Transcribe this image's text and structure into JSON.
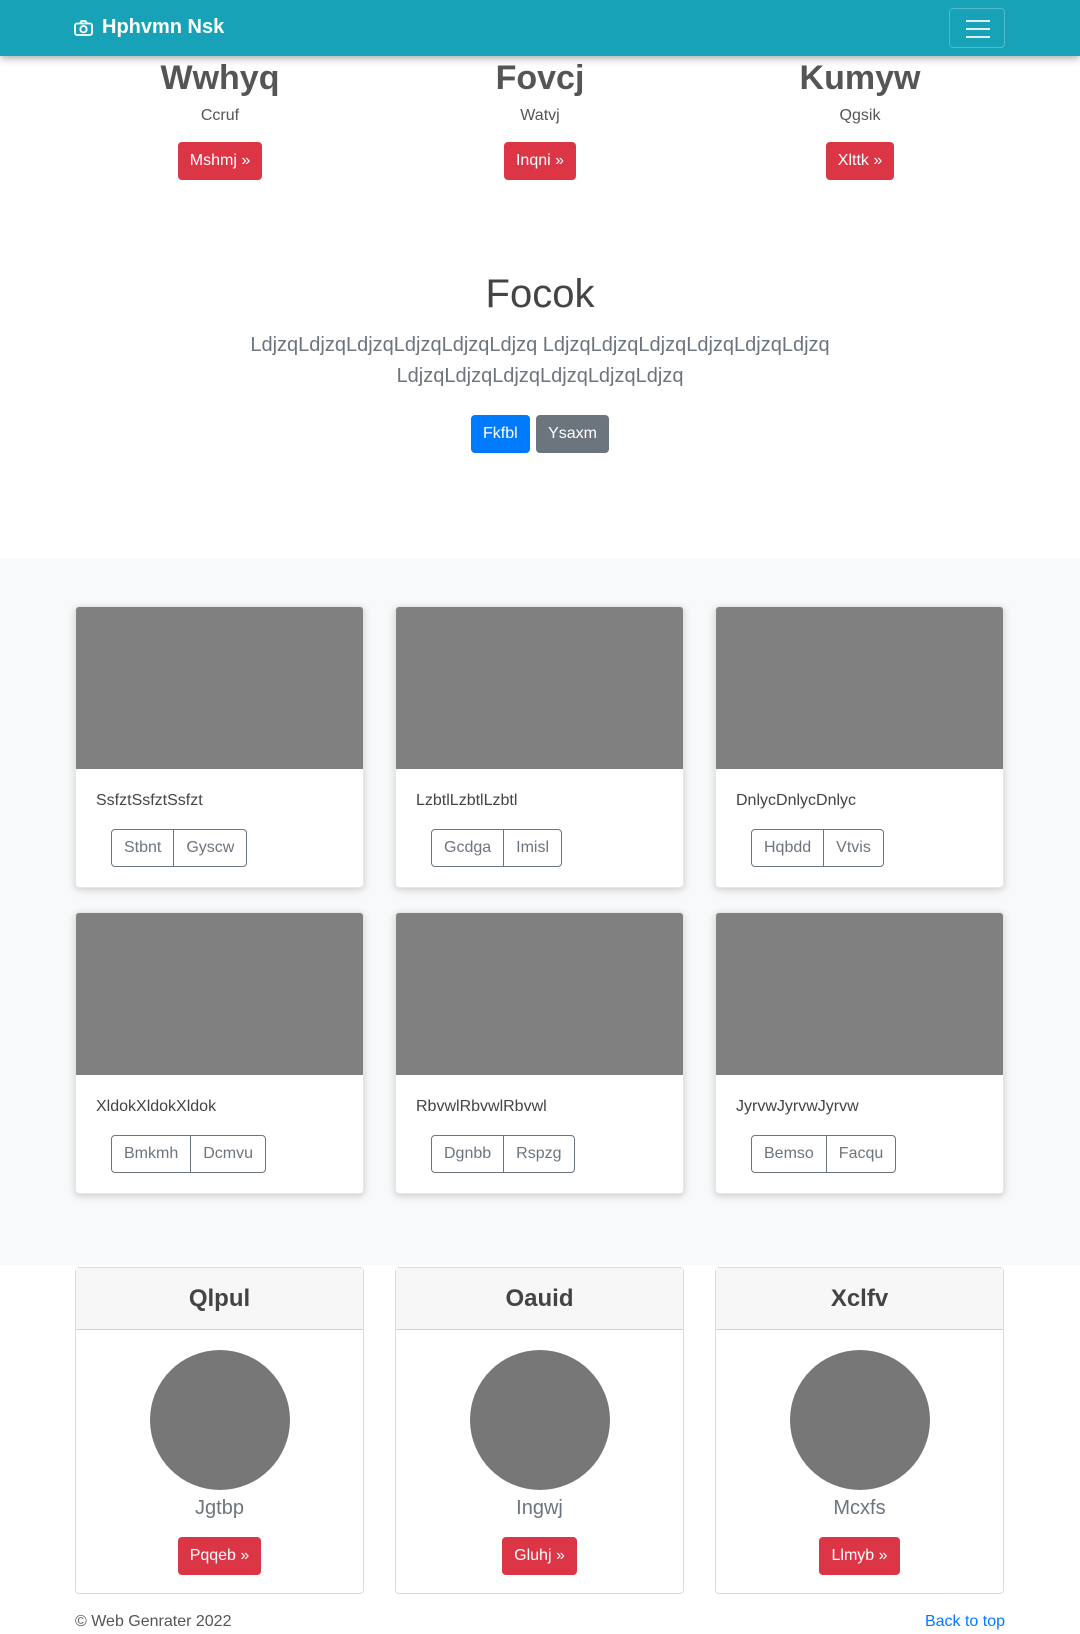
{
  "navbar": {
    "brand": "Hphvmn Nsk"
  },
  "features": [
    {
      "title": "Wwhyq",
      "text": "Ccruf",
      "button": "Mshmj »"
    },
    {
      "title": "Fovcj",
      "text": "Watvj",
      "button": "Inqni »"
    },
    {
      "title": "Kumyw",
      "text": "Qgsik",
      "button": "Xlttk »"
    }
  ],
  "jumbotron": {
    "title": "Focok",
    "lead": "LdjzqLdjzqLdjzqLdjzqLdjzqLdjzq LdjzqLdjzqLdjzqLdjzqLdjzqLdjzq LdjzqLdjzqLdjzqLdjzqLdjzqLdjzq",
    "primary_button": "Fkfbl",
    "secondary_button": "Ysaxm"
  },
  "album": [
    {
      "text": "SsfztSsfztSsfzt",
      "buttons": [
        "Stbnt",
        "Gyscw"
      ]
    },
    {
      "text": "LzbtlLzbtlLzbtl",
      "buttons": [
        "Gcdga",
        "Imisl"
      ]
    },
    {
      "text": "DnlycDnlycDnlyc",
      "buttons": [
        "Hqbdd",
        "Vtvis"
      ]
    },
    {
      "text": "XldokXldokXldok",
      "buttons": [
        "Bmkmh",
        "Dcmvu"
      ]
    },
    {
      "text": "RbvwlRbvwlRbvwl",
      "buttons": [
        "Dgnbb",
        "Rspzg"
      ]
    },
    {
      "text": "JyrvwJyrvwJyrvw",
      "buttons": [
        "Bemso",
        "Facqu"
      ]
    }
  ],
  "profiles": [
    {
      "header": "Qlpul",
      "name": "Jgtbp",
      "button": "Pqqeb »"
    },
    {
      "header": "Oauid",
      "name": "Ingwj",
      "button": "Gluhj »"
    },
    {
      "header": "Xclfv",
      "name": "Mcxfs",
      "button": "Llmyb »"
    }
  ],
  "footer": {
    "copyright": "© Web Genrater 2022",
    "back_to_top": "Back to top"
  }
}
